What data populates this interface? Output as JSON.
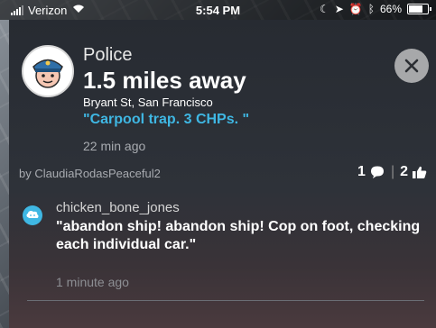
{
  "status_bar": {
    "carrier": "Verizon",
    "time": "5:54 PM",
    "battery": "66%"
  },
  "alert": {
    "title": "Police",
    "distance": "1.5 miles away",
    "address": "Bryant St, San Francisco",
    "quote": "\"Carpool trap. 3 CHPs. \"",
    "time_ago": "22 min ago",
    "reporter": "by ClaudiaRodasPeaceful2",
    "comment_count": "1",
    "thanks_count": "2"
  },
  "comment": {
    "author": "chicken_bone_jones",
    "text": "\"abandon ship!  abandon ship!  Cop on foot, checking each individual car.\"",
    "time_ago": "1 minute ago"
  },
  "colors": {
    "accent": "#3fb7e3",
    "close_button": "#a7a8aa"
  }
}
